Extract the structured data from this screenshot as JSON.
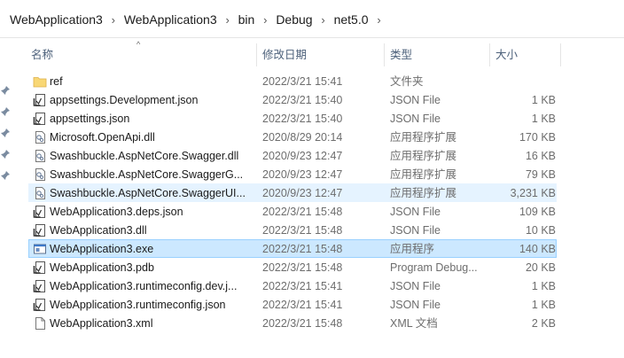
{
  "breadcrumb": [
    "WebApplication3",
    "WebApplication3",
    "bin",
    "Debug",
    "net5.0"
  ],
  "columns": {
    "name": "名称",
    "date": "修改日期",
    "type": "类型",
    "size": "大小"
  },
  "files": [
    {
      "name": "ref",
      "date": "2022/3/21 15:41",
      "type": "文件夹",
      "size": "",
      "icon": "folder-icon"
    },
    {
      "name": "appsettings.Development.json",
      "date": "2022/3/21 15:40",
      "type": "JSON File",
      "size": "1 KB",
      "icon": "json-file-icon"
    },
    {
      "name": "appsettings.json",
      "date": "2022/3/21 15:40",
      "type": "JSON File",
      "size": "1 KB",
      "icon": "json-file-icon"
    },
    {
      "name": "Microsoft.OpenApi.dll",
      "date": "2020/8/29 20:14",
      "type": "应用程序扩展",
      "size": "170 KB",
      "icon": "dll-file-icon"
    },
    {
      "name": "Swashbuckle.AspNetCore.Swagger.dll",
      "date": "2020/9/23 12:47",
      "type": "应用程序扩展",
      "size": "16 KB",
      "icon": "dll-file-icon"
    },
    {
      "name": "Swashbuckle.AspNetCore.SwaggerG...",
      "date": "2020/9/23 12:47",
      "type": "应用程序扩展",
      "size": "79 KB",
      "icon": "dll-file-icon"
    },
    {
      "name": "Swashbuckle.AspNetCore.SwaggerUI...",
      "date": "2020/9/23 12:47",
      "type": "应用程序扩展",
      "size": "3,231 KB",
      "icon": "dll-file-icon"
    },
    {
      "name": "WebApplication3.deps.json",
      "date": "2022/3/21 15:48",
      "type": "JSON File",
      "size": "109 KB",
      "icon": "json-file-icon"
    },
    {
      "name": "WebApplication3.dll",
      "date": "2022/3/21 15:48",
      "type": "JSON File",
      "size": "10 KB",
      "icon": "json-file-icon"
    },
    {
      "name": "WebApplication3.exe",
      "date": "2022/3/21 15:48",
      "type": "应用程序",
      "size": "140 KB",
      "icon": "exe-file-icon"
    },
    {
      "name": "WebApplication3.pdb",
      "date": "2022/3/21 15:48",
      "type": "Program Debug...",
      "size": "20 KB",
      "icon": "json-file-icon"
    },
    {
      "name": "WebApplication3.runtimeconfig.dev.j...",
      "date": "2022/3/21 15:41",
      "type": "JSON File",
      "size": "1 KB",
      "icon": "json-file-icon"
    },
    {
      "name": "WebApplication3.runtimeconfig.json",
      "date": "2022/3/21 15:41",
      "type": "JSON File",
      "size": "1 KB",
      "icon": "json-file-icon"
    },
    {
      "name": "WebApplication3.xml",
      "date": "2022/3/21 15:48",
      "type": "XML 文档",
      "size": "2 KB",
      "icon": "generic-file-icon"
    }
  ],
  "hovered_row": 6,
  "selected_row": 9
}
